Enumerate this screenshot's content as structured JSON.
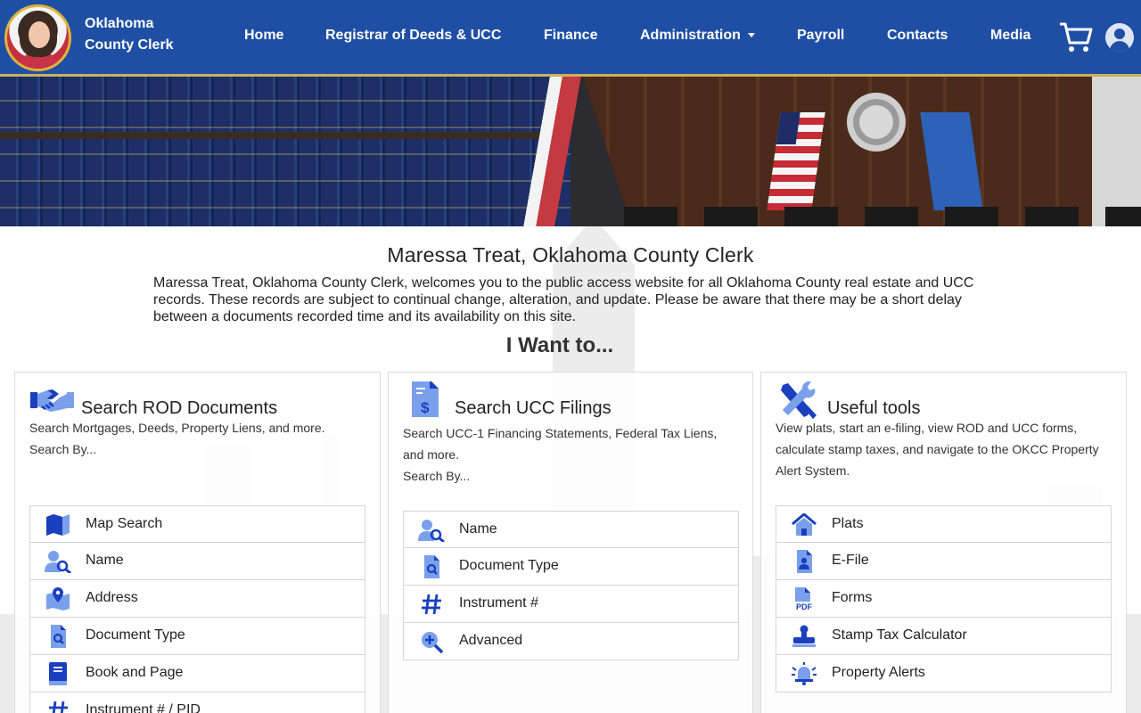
{
  "header": {
    "brand": "Oklahoma County Clerk",
    "nav": [
      {
        "label": "Home"
      },
      {
        "label": "Registrar of Deeds & UCC"
      },
      {
        "label": "Finance"
      },
      {
        "label": "Administration"
      },
      {
        "label": "Payroll"
      },
      {
        "label": "Contacts"
      },
      {
        "label": "Media"
      }
    ]
  },
  "intro": {
    "title": "Maressa Treat, Oklahoma County Clerk",
    "text": "Maressa Treat, Oklahoma County Clerk, welcomes you to the public access website for all Oklahoma County real estate and UCC records. These records are subject to continual change, alteration, and update. Please be aware that there may be a short delay between a documents recorded time and its availability on this site.",
    "iwant": "I Want to..."
  },
  "cards": [
    {
      "title": "Search ROD Documents",
      "desc": "Search Mortgages, Deeds, Property Liens, and more.",
      "search_by": "Search By...",
      "items": [
        {
          "label": "Map Search",
          "icon": "map-icon"
        },
        {
          "label": "Name",
          "icon": "person-search-icon"
        },
        {
          "label": "Address",
          "icon": "map-pin-icon"
        },
        {
          "label": "Document Type",
          "icon": "document-search-icon"
        },
        {
          "label": "Book and Page",
          "icon": "book-icon"
        },
        {
          "label": "Instrument # / PID",
          "icon": "hash-icon"
        }
      ]
    },
    {
      "title": "Search UCC Filings",
      "desc": "Search UCC-1 Financing Statements, Federal Tax Liens, and more.",
      "search_by": "Search By...",
      "items": [
        {
          "label": "Name",
          "icon": "person-search-icon"
        },
        {
          "label": "Document Type",
          "icon": "document-search-icon"
        },
        {
          "label": "Instrument #",
          "icon": "hash-icon"
        },
        {
          "label": "Advanced",
          "icon": "zoom-plus-icon"
        }
      ]
    },
    {
      "title": "Useful tools",
      "desc": "View plats, start an e-filing, view ROD and UCC forms, calculate stamp taxes, and navigate to the OKCC Property Alert System.",
      "items": [
        {
          "label": "Plats",
          "icon": "house-icon"
        },
        {
          "label": "E-File",
          "icon": "file-person-icon"
        },
        {
          "label": "Forms",
          "icon": "pdf-icon"
        },
        {
          "label": "Stamp Tax Calculator",
          "icon": "stamp-icon"
        },
        {
          "label": "Property Alerts",
          "icon": "bell-alert-icon"
        }
      ]
    }
  ],
  "colors": {
    "header_bg": "#1f4fa4",
    "accent": "#1a3fbf",
    "icon_light": "#7aa0ec",
    "header_border": "#c9b25a"
  }
}
